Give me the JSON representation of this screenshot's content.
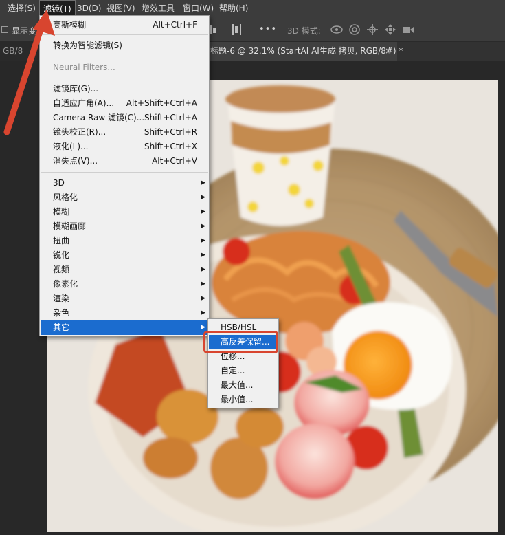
{
  "menubar": {
    "items": [
      {
        "label": "选择(S)"
      },
      {
        "label": "滤镜(T)"
      },
      {
        "label": "3D(D)"
      },
      {
        "label": "视图(V)"
      },
      {
        "label": "增效工具"
      },
      {
        "label": "窗口(W)"
      },
      {
        "label": "帮助(H)"
      }
    ],
    "active_index": 1
  },
  "options_bar": {
    "show_label": "显示变",
    "mode_label": "3D 模式:",
    "more_glyph": "•••"
  },
  "tabs": [
    {
      "label": "GB/8"
    },
    {
      "label": "标题-6 @ 32.1% (StartAI AI生成 拷贝, RGB/8#) *"
    }
  ],
  "tab_close_glyph": "×",
  "filter_menu": {
    "items": [
      {
        "label": "高斯模糊",
        "shortcut": "Alt+Ctrl+F"
      },
      {
        "label": "转换为智能滤镜(S)",
        "shortcut": ""
      },
      {
        "label": "Neural Filters...",
        "shortcut": "",
        "disabled": true
      },
      {
        "label": "滤镜库(G)...",
        "shortcut": ""
      },
      {
        "label": "自适应广角(A)...",
        "shortcut": "Alt+Shift+Ctrl+A"
      },
      {
        "label": "Camera Raw 滤镜(C)...",
        "shortcut": "Shift+Ctrl+A"
      },
      {
        "label": "镜头校正(R)...",
        "shortcut": "Shift+Ctrl+R"
      },
      {
        "label": "液化(L)...",
        "shortcut": "Shift+Ctrl+X"
      },
      {
        "label": "消失点(V)...",
        "shortcut": "Alt+Ctrl+V"
      },
      {
        "label": "3D",
        "submenu": true
      },
      {
        "label": "风格化",
        "submenu": true
      },
      {
        "label": "模糊",
        "submenu": true
      },
      {
        "label": "模糊画廊",
        "submenu": true
      },
      {
        "label": "扭曲",
        "submenu": true
      },
      {
        "label": "锐化",
        "submenu": true
      },
      {
        "label": "视频",
        "submenu": true
      },
      {
        "label": "像素化",
        "submenu": true
      },
      {
        "label": "渲染",
        "submenu": true
      },
      {
        "label": "杂色",
        "submenu": true
      },
      {
        "label": "其它",
        "submenu": true,
        "highlighted": true
      }
    ]
  },
  "submenu_other": {
    "items": [
      {
        "label": "HSB/HSL"
      },
      {
        "label": "高反差保留...",
        "highlighted": true
      },
      {
        "label": "位移..."
      },
      {
        "label": "自定..."
      },
      {
        "label": "最大值..."
      },
      {
        "label": "最小值..."
      }
    ]
  },
  "colors": {
    "highlight": "#1b6ccf",
    "annotation_red": "#d8452f",
    "menu_bg": "#f0f0f0",
    "ui_dark": "#3c3c3c"
  },
  "icons": {
    "arrow": "submenu-arrow-icon",
    "annotation": "red-pointer-arrow"
  }
}
